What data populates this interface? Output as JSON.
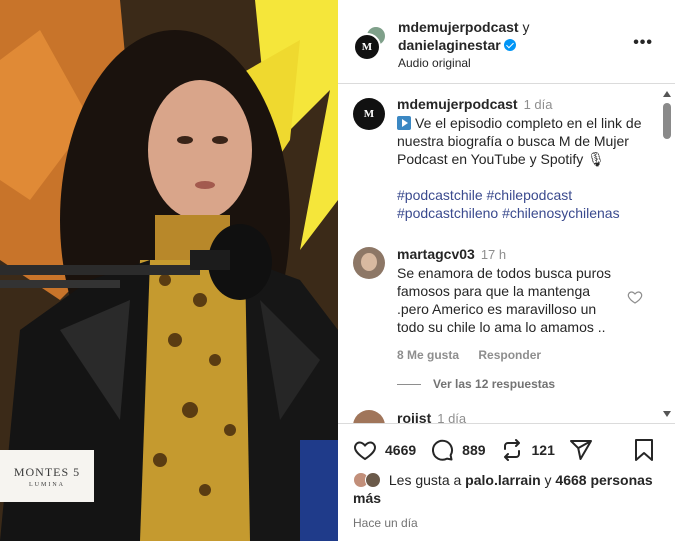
{
  "video": {
    "watermark_main": "MONTES",
    "watermark_suffix": "5",
    "watermark_sub": "LUMINA"
  },
  "header": {
    "user1": "mdemujerpodcast",
    "connector": "y",
    "user2": "danielaginestar",
    "audio": "Audio original",
    "more_icon": "more-horizontal-icon"
  },
  "caption": {
    "avatar_text": "M",
    "username": "mdemujerpodcast",
    "time": "1 día",
    "text": "Ve el episodio completo en el link de nuestra biografía o busca M de Mujer Podcast en YouTube y Spotify 🎙",
    "hashtags": [
      "#podcastchile",
      "#chilepodcast",
      "#podcastchileno",
      "#chilenosychilenas"
    ]
  },
  "comment": {
    "username": "martagcv03",
    "time": "17 h",
    "text": "Se enamora de todos busca puros famosos para que la mantenga .pero Americo es maravilloso un todo su chile lo ama lo amamos ..",
    "likes": "8 Me gusta",
    "reply": "Responder",
    "view_replies": "Ver las 12 respuestas"
  },
  "comment2": {
    "username": "rojist",
    "time": "1 día"
  },
  "actions": {
    "like_count": "4669",
    "comment_count": "889",
    "repost_count": "121"
  },
  "likes": {
    "prefix": "Les gusta a",
    "user": "palo.larrain",
    "middle": "y",
    "others": "4668 personas más"
  },
  "posted": "Hace un día",
  "colors": {
    "accent": "#0095f6",
    "hashtag": "#3a4a8e",
    "muted": "#8e8e8e",
    "border": "#dbdbdb"
  }
}
